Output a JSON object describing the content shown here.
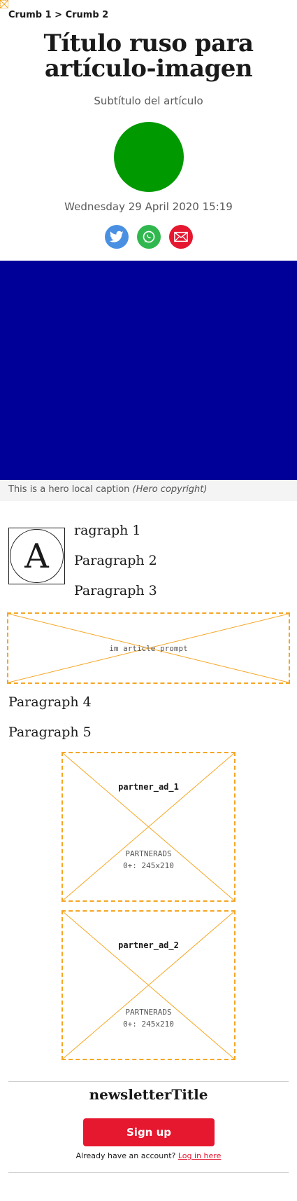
{
  "breadcrumb": {
    "items": [
      "Crumb 1",
      "Crumb 2"
    ],
    "separator": " > "
  },
  "article": {
    "title": "Título ruso para artículo-imagen",
    "subtitle": "Subtítulo del artículo",
    "date": "Wednesday 29 April 2020 15:19"
  },
  "share": {
    "icons": [
      "twitter-icon",
      "whatsapp-icon",
      "email-icon"
    ]
  },
  "hero": {
    "caption": "This is a hero local caption",
    "copyright": "(Hero copyright)"
  },
  "dropcap": {
    "letter": "A"
  },
  "paragraphs": [
    "ragraph 1",
    "Paragraph 2",
    "Paragraph 3",
    "Paragraph 4",
    "Paragraph 5"
  ],
  "im_article_prompt": {
    "label": "im article prompt"
  },
  "partner_ads": [
    {
      "name": "partner_ad_1",
      "line1": "PARTNERADS",
      "line2": "0+: 245x210"
    },
    {
      "name": "partner_ad_2",
      "line1": "PARTNERADS",
      "line2": "0+: 245x210"
    }
  ],
  "newsletter": {
    "title": "newsletterTitle",
    "signup_label": "Sign up",
    "account_text": "Already have an account?",
    "login_label": "Log in here"
  },
  "colors": {
    "avatar": "#009900",
    "hero": "#000099",
    "placeholder_border": "#f5a623",
    "accent_red": "#e5182f",
    "twitter": "#4a90e2",
    "whatsapp": "#30b84e"
  }
}
